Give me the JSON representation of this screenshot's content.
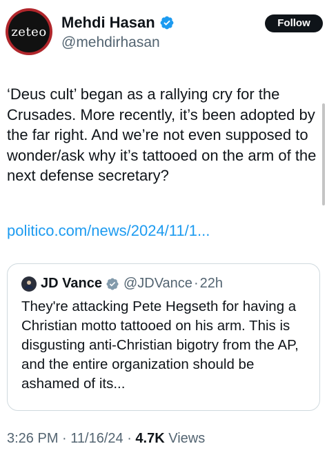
{
  "author": {
    "avatar_text": "zeteo",
    "display_name": "Mehdi Hasan",
    "handle": "@mehdirhasan"
  },
  "follow_label": "Follow",
  "tweet": {
    "text": "‘Deus cult’ began as a rallying cry for the Crusades. More recently, it’s been adopted by the far right. And we’re not even supposed to wonder/ask why it’s tattooed on the arm of the next defense secretary?",
    "link": "politico.com/news/2024/11/1..."
  },
  "quote": {
    "display_name": "JD Vance",
    "handle": "@JDVance",
    "separator": "·",
    "time": "22h",
    "text": "They're attacking Pete Hegseth for having a Christian motto tattooed on his arm. This is disgusting anti-Christian bigotry from the AP, and the entire organization should be ashamed of its..."
  },
  "meta": {
    "time": "3:26 PM",
    "sep1": " · ",
    "date": "11/16/24",
    "sep2": " · ",
    "views_count": "4.7K",
    "views_label": " Views"
  },
  "colors": {
    "link": "#1d9bf0",
    "verified": "#1d9bf0",
    "quote_verified": "#829aab",
    "avatar_ring": "#b0262b"
  }
}
